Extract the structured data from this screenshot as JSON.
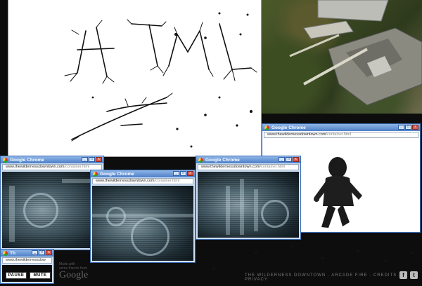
{
  "browser": {
    "title": "Google Chrome",
    "title_short": "Th",
    "url_host": "www.thewildernessdowntown.com",
    "url_path": "/container.html",
    "url_full": "www.thewildernessdowntown.com/container.html",
    "url_cut": "www.thewildernessdow"
  },
  "controls": {
    "pause_label": "PAUSE",
    "mute_label": "MUTE"
  },
  "footer": {
    "made_with_line1": "Made with",
    "made_with_line2": "some friends from",
    "google": "Google",
    "nav_text": "THE WILDERNESS DOWNTOWN  ·  ARCADE FIRE  ·  CREDITS  ·  PRIVACY"
  },
  "icons": [
    "facebook-icon",
    "twitter-icon",
    "chrome-logo-icon",
    "minimize-icon",
    "maximize-icon",
    "close-icon"
  ],
  "colors": {
    "titlebar_top": "#8fb6e6",
    "titlebar_bottom": "#4d7fc8",
    "page_bg": "#0d0d0d"
  }
}
